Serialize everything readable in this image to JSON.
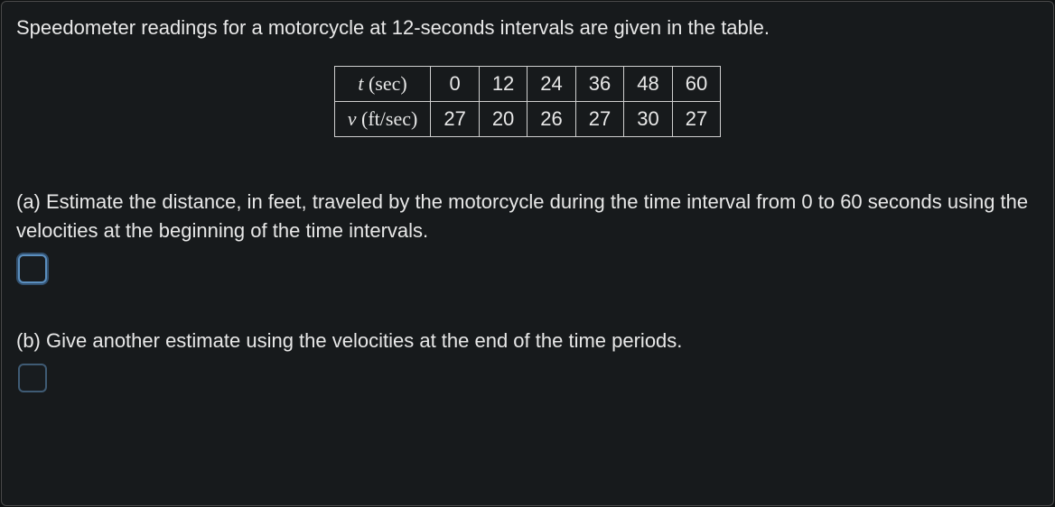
{
  "intro": "Speedometer readings for a motorcycle at 12-seconds intervals are given in the table.",
  "table": {
    "row1": {
      "var": "t",
      "unit_open": " (",
      "unit": "sec",
      "unit_close": ")",
      "values": [
        "0",
        "12",
        "24",
        "36",
        "48",
        "60"
      ]
    },
    "row2": {
      "var": "v",
      "unit_open": " (",
      "unit": "ft/sec",
      "unit_close": ")",
      "values": [
        "27",
        "20",
        "26",
        "27",
        "30",
        "27"
      ]
    }
  },
  "part_a": {
    "text": "(a) Estimate the distance, in feet, traveled by the motorcycle during the time interval from 0 to 60 seconds using the velocities at the beginning of the time intervals.",
    "value": ""
  },
  "part_b": {
    "text": "(b) Give another estimate using the velocities at the end of the time periods.",
    "value": ""
  }
}
